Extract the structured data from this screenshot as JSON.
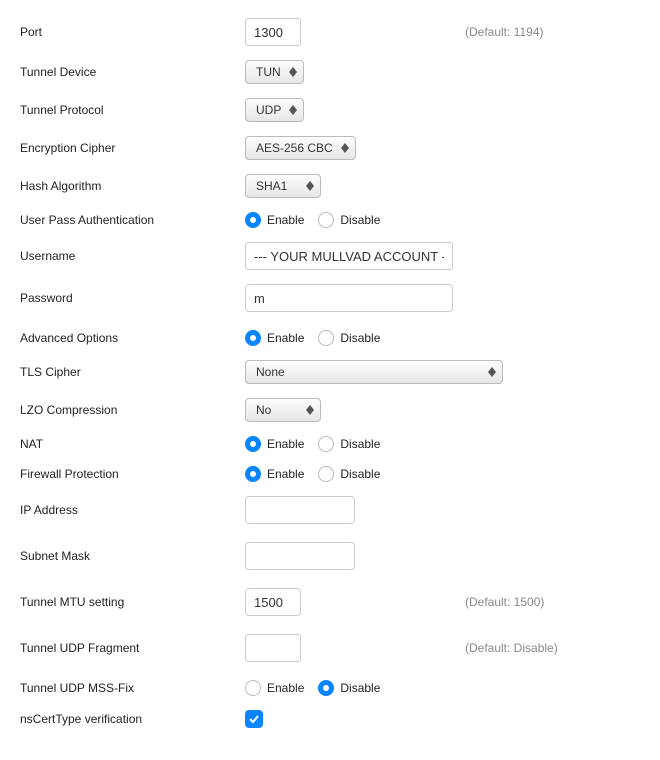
{
  "labels": {
    "port": "Port",
    "tunnel_device": "Tunnel Device",
    "tunnel_protocol": "Tunnel Protocol",
    "encryption_cipher": "Encryption Cipher",
    "hash_algorithm": "Hash Algorithm",
    "user_pass_auth": "User Pass Authentication",
    "username": "Username",
    "password": "Password",
    "advanced_options": "Advanced Options",
    "tls_cipher": "TLS Cipher",
    "lzo_compression": "LZO Compression",
    "nat": "NAT",
    "firewall_protection": "Firewall Protection",
    "ip_address": "IP Address",
    "subnet_mask": "Subnet Mask",
    "tunnel_mtu": "Tunnel MTU setting",
    "tunnel_udp_fragment": "Tunnel UDP Fragment",
    "tunnel_udp_mssfix": "Tunnel UDP MSS-Fix",
    "nscerttype": "nsCertType verification"
  },
  "values": {
    "port": "1300",
    "tunnel_device": "TUN",
    "tunnel_protocol": "UDP",
    "encryption_cipher": "AES-256 CBC",
    "hash_algorithm": "SHA1",
    "username": "--- YOUR MULLVAD ACCOUNT ---",
    "password": "m",
    "tls_cipher": "None",
    "lzo_compression": "No",
    "ip_address": "",
    "subnet_mask": "",
    "tunnel_mtu": "1500",
    "tunnel_udp_fragment": ""
  },
  "radio": {
    "enable": "Enable",
    "disable": "Disable"
  },
  "hints": {
    "port": "(Default: 1194)",
    "tunnel_mtu": "(Default: 1500)",
    "tunnel_udp_fragment": "(Default: Disable)"
  },
  "state": {
    "user_pass_auth": "enable",
    "advanced_options": "enable",
    "nat": "enable",
    "firewall_protection": "enable",
    "tunnel_udp_mssfix": "disable",
    "nscerttype": true
  }
}
